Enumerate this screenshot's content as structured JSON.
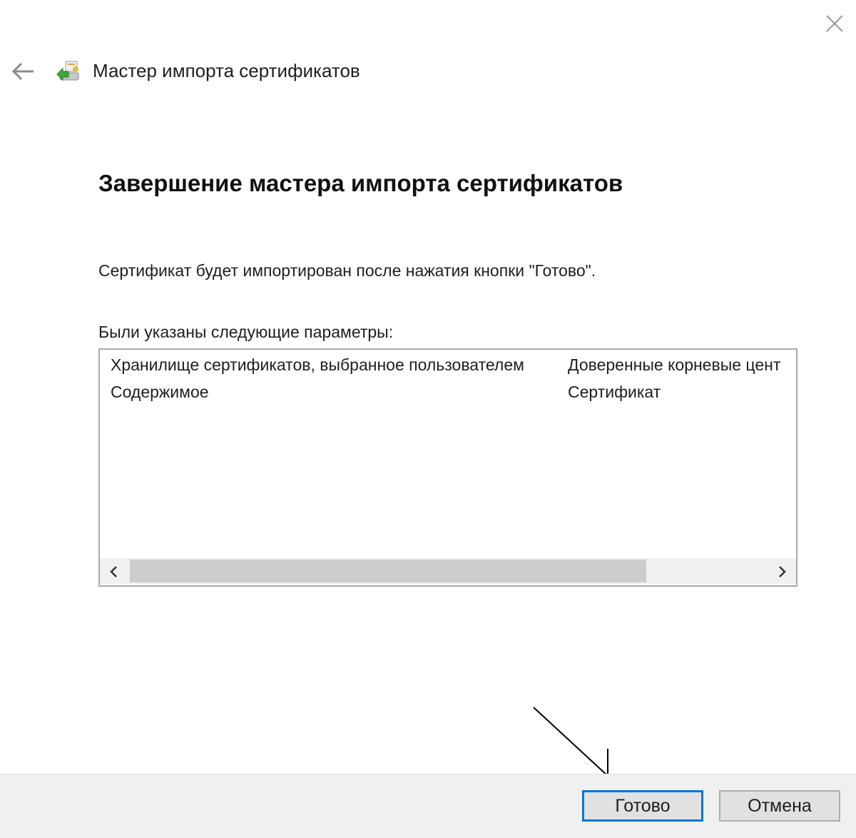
{
  "window": {
    "title": "Мастер импорта сертификатов",
    "back_icon": "arrow-left-icon",
    "close_icon": "close-icon",
    "app_icon": "certificate-wizard-icon"
  },
  "page": {
    "heading": "Завершение мастера импорта сертификатов",
    "info_text": "Сертификат будет импортирован после нажатия кнопки \"Готово\".",
    "params_label": "Были указаны следующие параметры:"
  },
  "params": {
    "rows": [
      {
        "name": "Хранилище сертификатов, выбранное пользователем",
        "value": "Доверенные корневые цент"
      },
      {
        "name": "Содержимое",
        "value": "Сертификат"
      }
    ],
    "scrollbar": {
      "left_icon": "chevron-left-icon",
      "right_icon": "chevron-right-icon"
    }
  },
  "buttons": {
    "finish_label": "Готово",
    "cancel_label": "Отмена"
  },
  "colors": {
    "accent": "#0078d7",
    "footer_bg": "#f0f0f0",
    "button_bg": "#e1e1e1"
  }
}
